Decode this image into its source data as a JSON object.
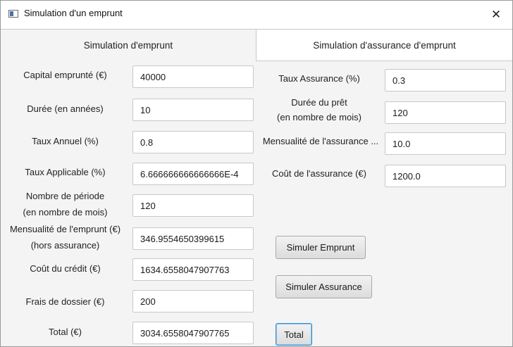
{
  "window": {
    "title": "Simulation d'un emprunt",
    "close_glyph": "✕"
  },
  "tabs": [
    {
      "label": "Simulation d'emprunt"
    },
    {
      "label": "Simulation d'assurance d'emprunt"
    }
  ],
  "loan": {
    "capital": {
      "label": "Capital emprunté (€)",
      "value": "40000"
    },
    "duree": {
      "label": "Durée (en années)",
      "value": "10"
    },
    "taux_annuel": {
      "label": "Taux Annuel (%)",
      "value": "0.8"
    },
    "taux_applicable": {
      "label": "Taux Applicable (%)",
      "value": "6.666666666666666E-4"
    },
    "nb_periode": {
      "label_line1": "Nombre de période",
      "label_line2": "(en nombre de mois)",
      "value": "120"
    },
    "mensualite": {
      "label_line1": "Mensualité de l'emprunt (€)",
      "label_line2": "(hors assurance)",
      "value": "346.9554650399615"
    },
    "cout_credit": {
      "label": "Coût du crédit (€)",
      "value": "1634.6558047907763"
    },
    "frais_dossier": {
      "label": "Frais de dossier (€)",
      "value": "200"
    },
    "total": {
      "label": "Total (€)",
      "value": "3034.6558047907765"
    }
  },
  "insurance": {
    "taux_assurance": {
      "label": "Taux Assurance (%)",
      "value": "0.3"
    },
    "duree_pret": {
      "label_line1": "Durée du prêt",
      "label_line2": "(en nombre de mois)",
      "value": "120"
    },
    "mensualite_assurance": {
      "label": "Mensualité de l'assurance ...",
      "value": "10.0"
    },
    "cout_assurance": {
      "label": "Coût de l'assurance (€)",
      "value": "1200.0"
    }
  },
  "buttons": {
    "simuler_emprunt": "Simuler Emprunt",
    "simuler_assurance": "Simuler Assurance",
    "total": "Total"
  }
}
